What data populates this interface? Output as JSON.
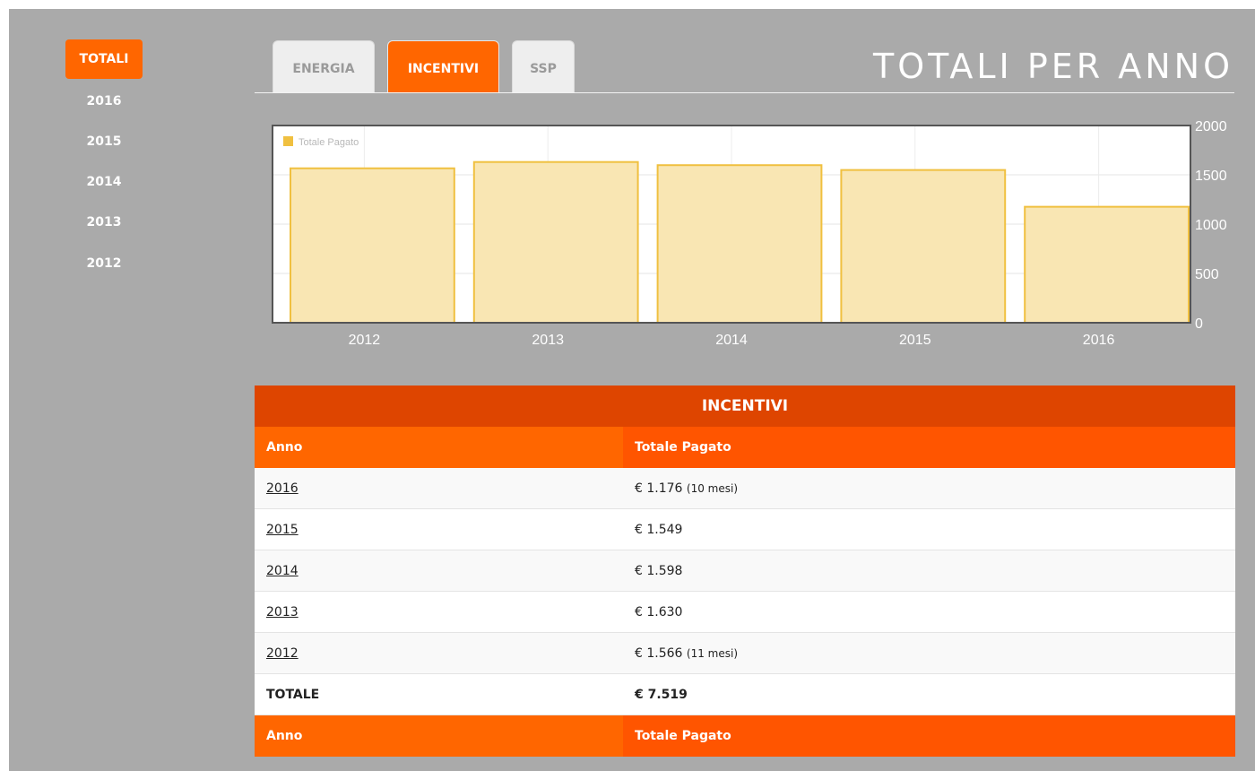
{
  "sidebar": {
    "active": "TOTALI",
    "items": [
      "2016",
      "2015",
      "2014",
      "2013",
      "2012"
    ]
  },
  "tabs": [
    {
      "label": "ENERGIA",
      "active": false
    },
    {
      "label": "INCENTIVI",
      "active": true
    },
    {
      "label": "SSP",
      "active": false
    }
  ],
  "page_title": "TOTALI PER ANNO",
  "colors": {
    "accent": "#ff6600",
    "table_title_bg": "#de4500",
    "bar_fill": "#f9e6b3",
    "bar_stroke": "#f0c040",
    "legend_swatch": "#f0c040"
  },
  "chart_data": {
    "type": "bar",
    "categories": [
      "2012",
      "2013",
      "2014",
      "2015",
      "2016"
    ],
    "series": [
      {
        "name": "Totale Pagato",
        "values": [
          1566,
          1630,
          1598,
          1549,
          1176
        ]
      }
    ],
    "ylim": [
      0,
      2000
    ],
    "yticks": [
      "0",
      "500",
      "1000",
      "1500",
      "2000"
    ],
    "y_axis_side": "right",
    "legend_position": "top-left",
    "grid": true
  },
  "table": {
    "title": "INCENTIVI",
    "columns": [
      "Anno",
      "Totale Pagato"
    ],
    "rows": [
      {
        "year": "2016",
        "amount": "€ 1.176",
        "note": "(10 mesi)"
      },
      {
        "year": "2015",
        "amount": "€ 1.549",
        "note": ""
      },
      {
        "year": "2014",
        "amount": "€ 1.598",
        "note": ""
      },
      {
        "year": "2013",
        "amount": "€ 1.630",
        "note": ""
      },
      {
        "year": "2012",
        "amount": "€ 1.566",
        "note": "(11 mesi)"
      }
    ],
    "total_label": "TOTALE",
    "total_value": "€ 7.519",
    "footer_columns": [
      "Anno",
      "Totale Pagato"
    ]
  }
}
